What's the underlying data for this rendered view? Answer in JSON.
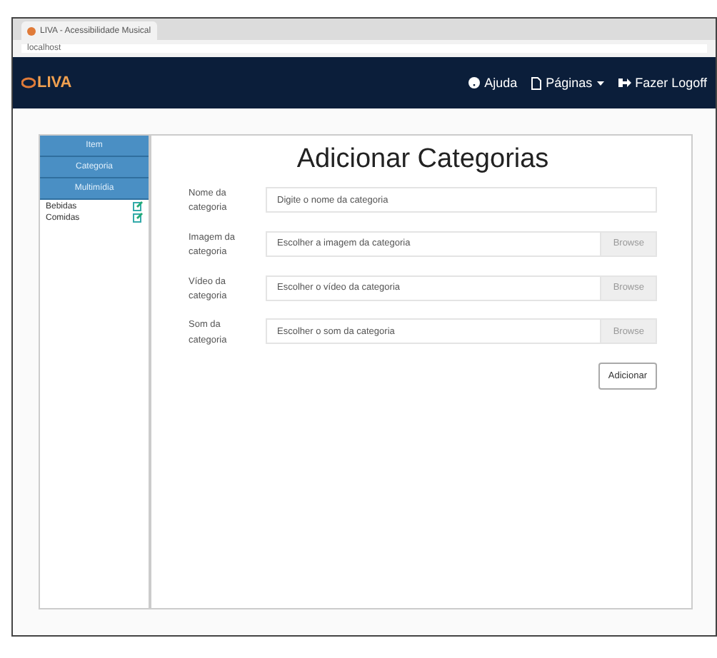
{
  "browser": {
    "tab_title": "LIVA - Acessibilidade Musical",
    "url": "localhost"
  },
  "navbar": {
    "logo": "LIVA",
    "links": [
      {
        "label": "Ajuda",
        "kind": "help"
      },
      {
        "label": "Páginas",
        "kind": "pages"
      },
      {
        "label": "Fazer Logoff",
        "kind": "logout"
      }
    ]
  },
  "sidebar": {
    "sections": [
      "Item",
      "Categoria",
      "Multimídia"
    ],
    "items": [
      {
        "label": "Bebidas"
      },
      {
        "label": "Comidas"
      }
    ]
  },
  "form": {
    "title": "Adicionar Categorias",
    "fields": [
      {
        "label": "Nome da categoria",
        "placeholder": "Digite o nome da categoria",
        "kind": "text"
      },
      {
        "label": "Imagem da categoria",
        "placeholder": "Escolher a imagem da categoria",
        "kind": "file",
        "button": "Browse"
      },
      {
        "label": "Vídeo da categoria",
        "placeholder": "Escolher o vídeo da categoria",
        "kind": "file",
        "button": "Browse"
      },
      {
        "label": "Som da categoria",
        "placeholder": "Escolher o som da categoria",
        "kind": "file",
        "button": "Browse"
      }
    ],
    "submit": "Adicionar"
  }
}
